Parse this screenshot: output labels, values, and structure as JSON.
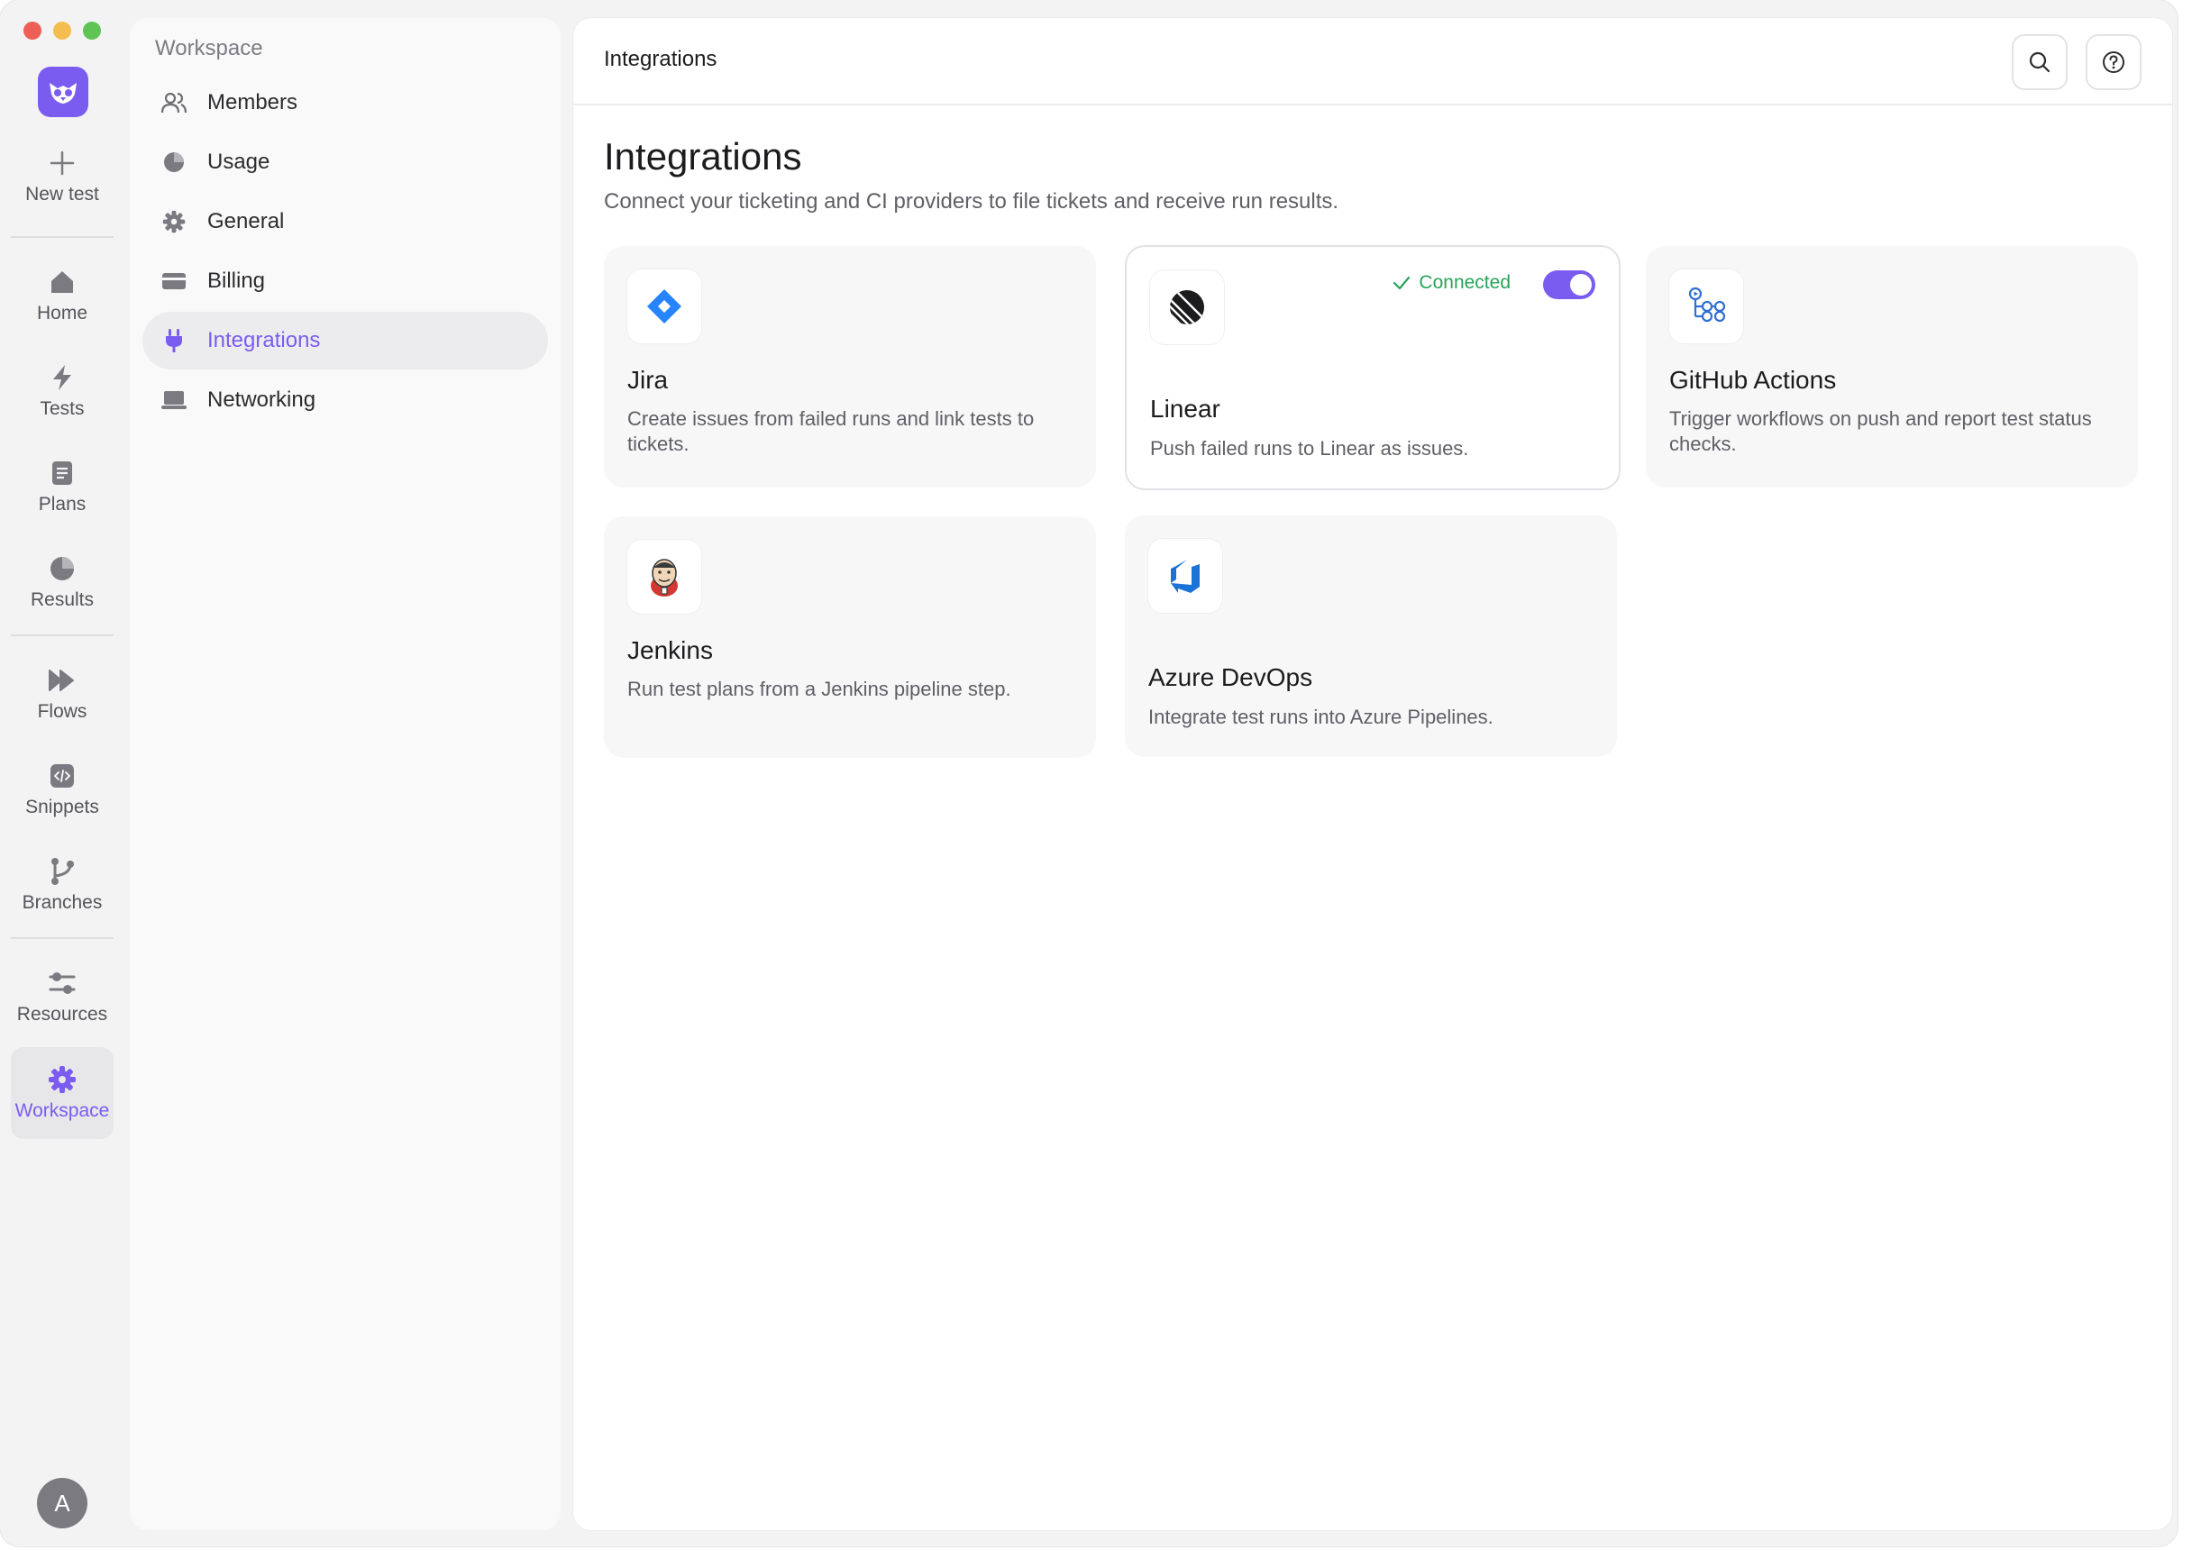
{
  "window": {
    "traffic_lights": [
      "#ee5f57",
      "#f4bd4f",
      "#5fc454"
    ]
  },
  "rail": {
    "new_test_label": "New test",
    "items": [
      {
        "label": "Home",
        "icon": "home-icon"
      },
      {
        "label": "Tests",
        "icon": "bolt-icon"
      },
      {
        "label": "Plans",
        "icon": "document-icon"
      },
      {
        "label": "Results",
        "icon": "pie-chart-icon"
      },
      {
        "label": "Flows",
        "icon": "fast-forward-icon"
      },
      {
        "label": "Snippets",
        "icon": "code-icon"
      },
      {
        "label": "Branches",
        "icon": "branch-icon"
      },
      {
        "label": "Resources",
        "icon": "sliders-icon"
      },
      {
        "label": "Workspace",
        "icon": "gear-icon",
        "active": true
      }
    ],
    "avatar_initial": "A"
  },
  "settings": {
    "title": "Workspace",
    "items": [
      {
        "label": "Members",
        "icon": "users-icon"
      },
      {
        "label": "Usage",
        "icon": "pie-chart-icon"
      },
      {
        "label": "General",
        "icon": "gear-icon"
      },
      {
        "label": "Billing",
        "icon": "credit-card-icon"
      },
      {
        "label": "Integrations",
        "icon": "plug-icon",
        "active": true
      },
      {
        "label": "Networking",
        "icon": "laptop-icon"
      }
    ]
  },
  "header": {
    "title": "Integrations"
  },
  "page": {
    "title": "Integrations",
    "subtitle": "Connect your ticketing and CI providers to file tickets and receive run results."
  },
  "integrations": [
    {
      "name": "Jira",
      "description": "Create issues from failed runs and link tests to tickets.",
      "icon": "jira-icon",
      "connected": false
    },
    {
      "name": "Linear",
      "description": "Push failed runs to Linear as issues.",
      "icon": "linear-icon",
      "connected": true,
      "status": "Connected"
    },
    {
      "name": "GitHub Actions",
      "description": "Trigger workflows on push and report test status checks.",
      "icon": "github-actions-icon",
      "connected": false
    },
    {
      "name": "Jenkins",
      "description": "Run test plans from a Jenkins pipeline step.",
      "icon": "jenkins-icon",
      "connected": false
    },
    {
      "name": "Azure DevOps",
      "description": "Integrate test runs into Azure Pipelines.",
      "icon": "azure-devops-icon",
      "connected": false
    }
  ],
  "colors": {
    "accent": "#7b5cf0",
    "connected": "#27a35a"
  }
}
